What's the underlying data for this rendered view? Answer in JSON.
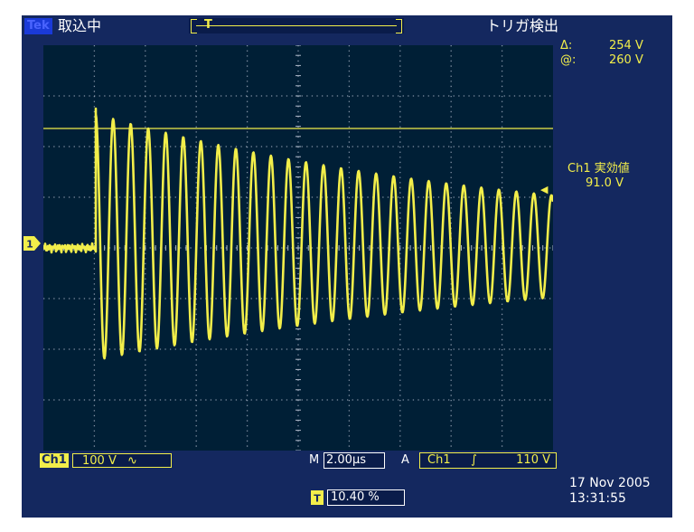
{
  "topbar": {
    "brand": "Tek",
    "acquisition_status": "取込中",
    "trigger_state": "トリガ検出"
  },
  "cursor": {
    "delta_label": "Δ:",
    "delta_value": "254 V",
    "at_label": "@:",
    "at_value": "260 V"
  },
  "measurement": {
    "label": "Ch1 実効値",
    "value": "91.0 V"
  },
  "channel": {
    "tag": "Ch1",
    "scale": "100 V",
    "coupling_symbol": "∿",
    "ground_marker": "1"
  },
  "horizontal": {
    "mode_prefix": "M",
    "timebase": "2.00µs",
    "trigger_position_percent": "10.40 %"
  },
  "trigger": {
    "mode": "A",
    "source": "Ch1",
    "slope_symbol": "∫",
    "level": "110 V",
    "marker": "T"
  },
  "timestamp": {
    "date": "17 Nov 2005",
    "time": "13:31:55"
  },
  "colors": {
    "background": "#14285f",
    "graticule": "#001f36",
    "trace": "#f2ee4a",
    "readout": "#ffffff"
  }
}
